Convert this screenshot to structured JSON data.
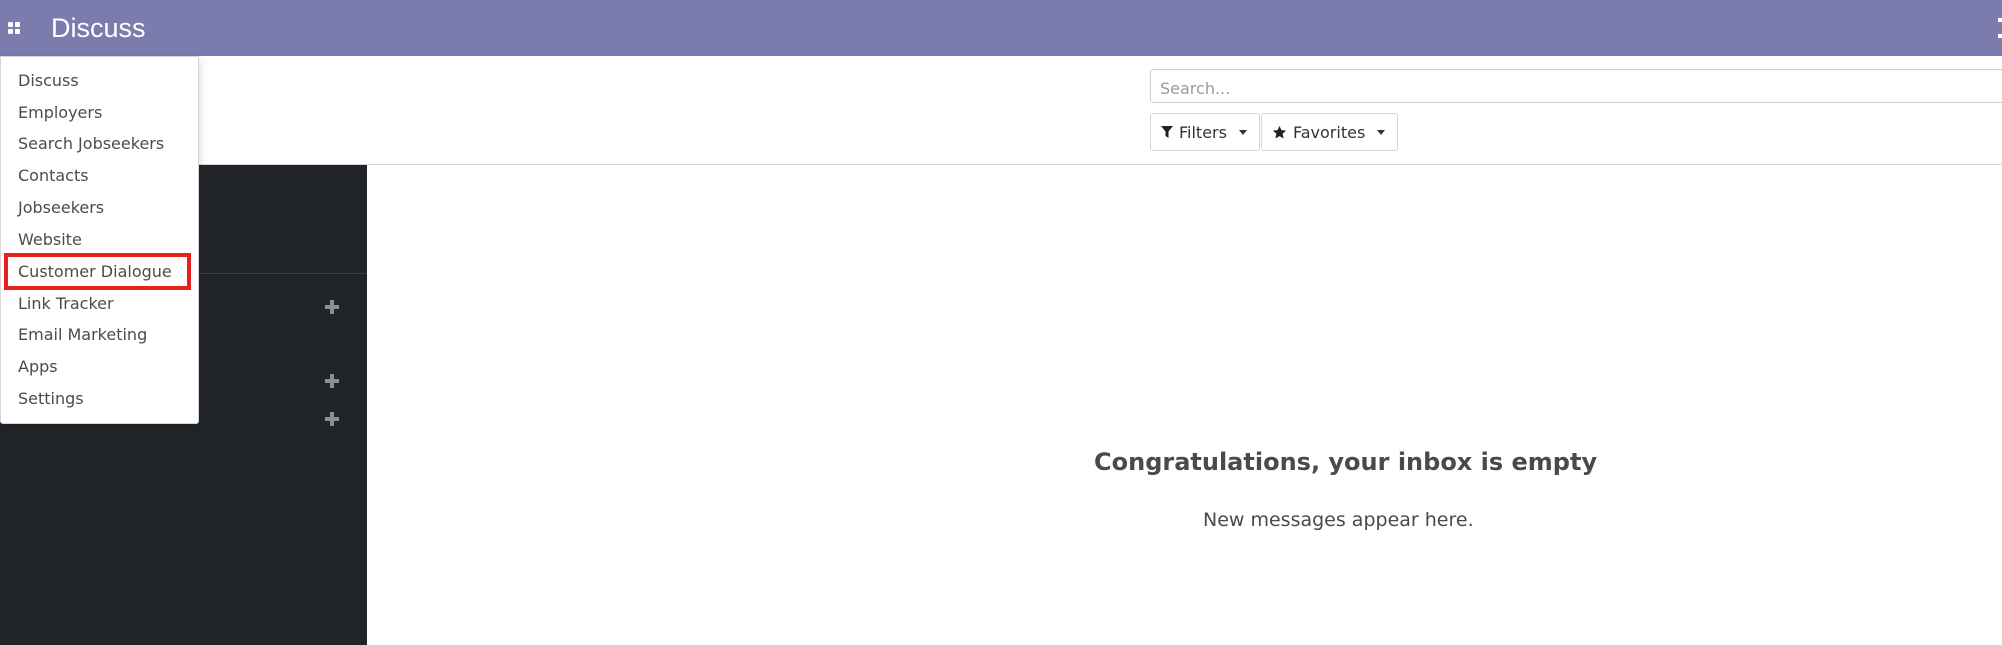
{
  "navbar": {
    "app_title": "Discuss",
    "apps_icon": "grid-icon",
    "color": "#7c7bad"
  },
  "search": {
    "placeholder": "Search..."
  },
  "filters": {
    "filters_label": "Filters",
    "favorites_label": "Favorites",
    "filter_icon": "funnel-icon",
    "favorites_icon": "star-icon"
  },
  "apps_menu": {
    "items": [
      {
        "label": "Discuss"
      },
      {
        "label": "Employers"
      },
      {
        "label": "Search Jobseekers"
      },
      {
        "label": "Contacts"
      },
      {
        "label": "Jobseekers"
      },
      {
        "label": "Website"
      },
      {
        "label": "Customer Dialogue",
        "highlighted": true
      },
      {
        "label": "Link Tracker"
      },
      {
        "label": "Email Marketing"
      },
      {
        "label": "Apps"
      },
      {
        "label": "Settings"
      }
    ],
    "highlight_color": "#e8211f"
  },
  "sidebar": {
    "add_icons": [
      "plus-icon",
      "plus-icon",
      "plus-icon"
    ],
    "background": "#212529"
  },
  "inbox": {
    "empty_title": "Congratulations, your inbox is empty",
    "empty_subtitle": "New messages appear here."
  }
}
